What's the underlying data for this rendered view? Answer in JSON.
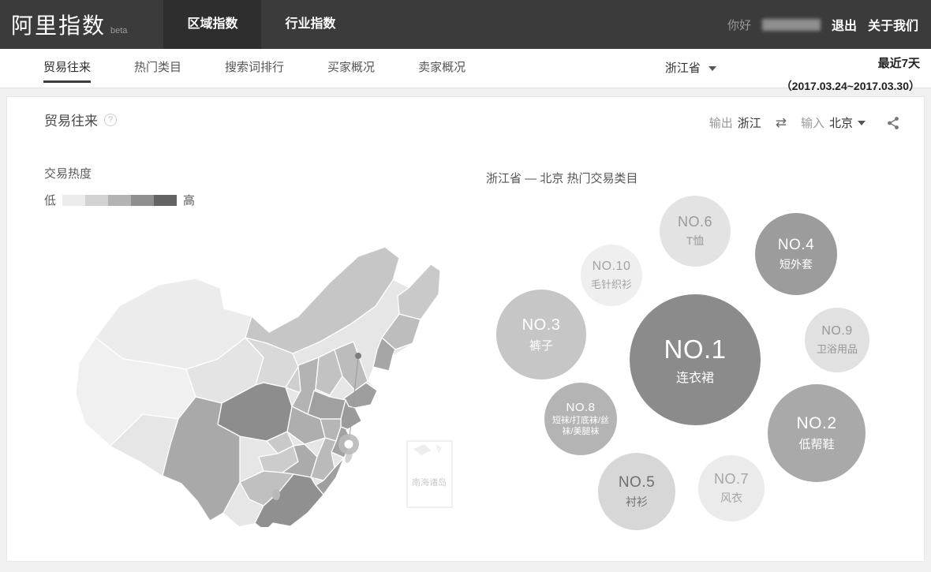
{
  "topnav": {
    "logo": "阿里指数",
    "logo_suffix": "beta",
    "tabs": [
      {
        "label": "区域指数",
        "active": true
      },
      {
        "label": "行业指数",
        "active": false
      }
    ],
    "greeting": "你好",
    "logout": "退出",
    "about": "关于我们"
  },
  "subnav": {
    "tabs": [
      {
        "label": "贸易往来",
        "active": true
      },
      {
        "label": "热门类目",
        "active": false
      },
      {
        "label": "搜索词排行",
        "active": false
      },
      {
        "label": "买家概况",
        "active": false
      },
      {
        "label": "卖家概况",
        "active": false
      }
    ],
    "province_selector": "浙江省",
    "period": "最近7天",
    "date_range": "（2017.03.24~2017.03.30）"
  },
  "section_header": {
    "title": "贸易往来",
    "help_glyph": "?",
    "output_label": "输出",
    "output_value": "浙江",
    "swap_glyph": "⇄",
    "input_label": "输入",
    "input_value": "北京"
  },
  "map_panel": {
    "legend_title": "交易热度",
    "legend_low": "低",
    "legend_high": "高",
    "legend_colors": [
      "#ebebeb",
      "#d2d2d2",
      "#b3b3b3",
      "#8f8f8f",
      "#636363"
    ],
    "inset_label": "南海诸岛"
  },
  "bubble_panel": {
    "title": "浙江省 — 北京 热门交易类目",
    "bubbles": [
      {
        "rank": "NO.1",
        "label": "连衣裙"
      },
      {
        "rank": "NO.2",
        "label": "低帮鞋"
      },
      {
        "rank": "NO.3",
        "label": "裤子"
      },
      {
        "rank": "NO.4",
        "label": "短外套"
      },
      {
        "rank": "NO.5",
        "label": "衬衫"
      },
      {
        "rank": "NO.6",
        "label": "T恤"
      },
      {
        "rank": "NO.7",
        "label": "风衣"
      },
      {
        "rank": "NO.8",
        "label": "短袜/打底袜/丝袜/美腿袜"
      },
      {
        "rank": "NO.9",
        "label": "卫浴用品"
      },
      {
        "rank": "NO.10",
        "label": "毛针织衫"
      }
    ]
  },
  "chart_data": {
    "type": "bubble",
    "title": "浙江省 — 北京 热门交易类目",
    "items": [
      {
        "rank": 1,
        "category": "连衣裙",
        "relative_size": 83
      },
      {
        "rank": 2,
        "category": "低帮鞋",
        "relative_size": 62
      },
      {
        "rank": 3,
        "category": "裤子",
        "relative_size": 57
      },
      {
        "rank": 4,
        "category": "短外套",
        "relative_size": 52
      },
      {
        "rank": 5,
        "category": "衬衫",
        "relative_size": 49
      },
      {
        "rank": 6,
        "category": "T恤",
        "relative_size": 45
      },
      {
        "rank": 7,
        "category": "风衣",
        "relative_size": 42
      },
      {
        "rank": 8,
        "category": "短袜/打底袜/丝袜/美腿袜",
        "relative_size": 46
      },
      {
        "rank": 9,
        "category": "卫浴用品",
        "relative_size": 41
      },
      {
        "rank": 10,
        "category": "毛针织衫",
        "relative_size": 39
      }
    ]
  }
}
